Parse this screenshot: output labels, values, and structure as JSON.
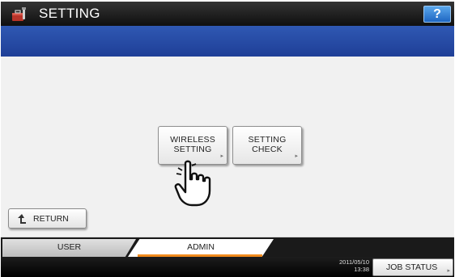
{
  "header": {
    "title": "SETTING",
    "help_label": "?"
  },
  "main": {
    "buttons": [
      {
        "line1": "WIRELESS",
        "line2": "SETTING",
        "arrow": "▸"
      },
      {
        "line1": "SETTING",
        "line2": "CHECK",
        "arrow": "▸"
      }
    ],
    "return_label": "RETURN"
  },
  "tabs": [
    {
      "label": "USER",
      "active": false
    },
    {
      "label": "ADMIN",
      "active": true
    }
  ],
  "footer": {
    "date": "2011/05/10",
    "time": "13:38",
    "job_status_label": "JOB STATUS",
    "job_status_arrow": "▸"
  },
  "icons": {
    "app": "setting-toolbox-icon",
    "hand": "pointing-hand-icon",
    "return": "return-arrow-icon"
  },
  "colors": {
    "title_bar": "#1a1a1a",
    "blue_band": "#2a4ea8",
    "help_button": "#2f7fd8",
    "active_tab_underline": "#f08a1c"
  }
}
